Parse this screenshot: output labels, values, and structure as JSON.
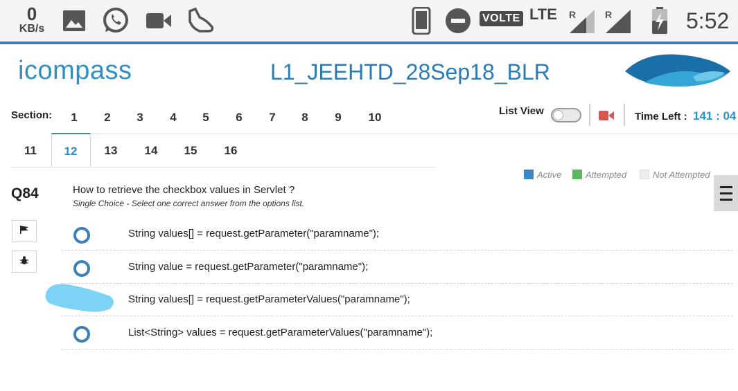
{
  "status_bar": {
    "speed_value": "0",
    "speed_unit": "KB/s",
    "volte": "VOLTE",
    "lte": "LTE",
    "roaming1": "R",
    "roaming2": "R",
    "time": "5:52",
    "icons": [
      "image-icon",
      "whatsapp-icon",
      "video-icon",
      "shoe-icon",
      "phone-icon",
      "dnd-icon",
      "signal-icon",
      "battery-charging-icon"
    ]
  },
  "header": {
    "logo_text": "icompass",
    "exam_title": "L1_JEEHTD_28Sep18_BLR"
  },
  "sections": {
    "label": "Section:",
    "row1": [
      "1",
      "2",
      "3",
      "4",
      "5",
      "6",
      "7",
      "8",
      "9",
      "10"
    ],
    "row2": [
      "11",
      "12",
      "13",
      "14",
      "15",
      "16"
    ],
    "active": "12"
  },
  "toolbar": {
    "list_view_label": "List View",
    "list_view_on": false,
    "time_left_label": "Time Left :",
    "time_left_value": "141 : 04"
  },
  "legend": {
    "active": "Active",
    "attempted": "Attempted",
    "not_attempted": "Not Attempted",
    "colors": {
      "active": "#3d86c6",
      "attempted": "#5cb85c",
      "not_attempted": "#eeeeee"
    }
  },
  "question": {
    "number": "Q84",
    "text": "How to retrieve the checkbox values in Servlet ?",
    "type": "Single Choice - Select one correct answer from the options list.",
    "options": [
      "String values[] = request.getParameter(\"paramname\");",
      "String value = request.getParameter(\"paramname\");",
      "String values[] = request.getParameterValues(\"paramname\");",
      "List<String> values = request.getParameterValues(\"paramname\");"
    ]
  },
  "colors": {
    "accent": "#2b90c4",
    "title": "#2b7cb5",
    "header_rule": "#3f7fb8"
  }
}
